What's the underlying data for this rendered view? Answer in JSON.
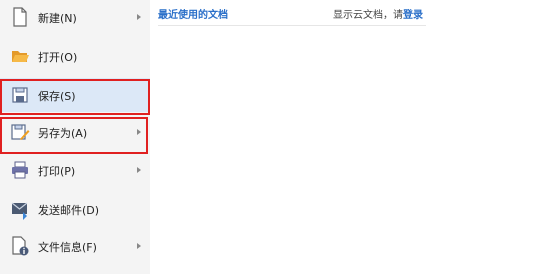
{
  "menu": {
    "items": [
      {
        "label": "新建(N)",
        "icon": "new-document-icon",
        "has_submenu": true
      },
      {
        "label": "打开(O)",
        "icon": "folder-open-icon",
        "has_submenu": false
      },
      {
        "label": "保存(S)",
        "icon": "save-icon",
        "has_submenu": false,
        "selected": true,
        "highlighted": true
      },
      {
        "label": "另存为(A)",
        "icon": "save-as-icon",
        "has_submenu": true,
        "highlighted": true
      },
      {
        "label": "打印(P)",
        "icon": "printer-icon",
        "has_submenu": true
      },
      {
        "label": "发送邮件(D)",
        "icon": "mail-send-icon",
        "has_submenu": false
      },
      {
        "label": "文件信息(F)",
        "icon": "file-info-icon",
        "has_submenu": true
      }
    ]
  },
  "recent": {
    "title": "最近使用的文档",
    "cloud_prefix": "显示云文档，请",
    "login_label": "登录"
  },
  "colors": {
    "accent": "#2a6fc9",
    "menu_bg": "#f4f4f4",
    "selected_bg": "#dce8f7",
    "highlight_border": "#e02020"
  }
}
